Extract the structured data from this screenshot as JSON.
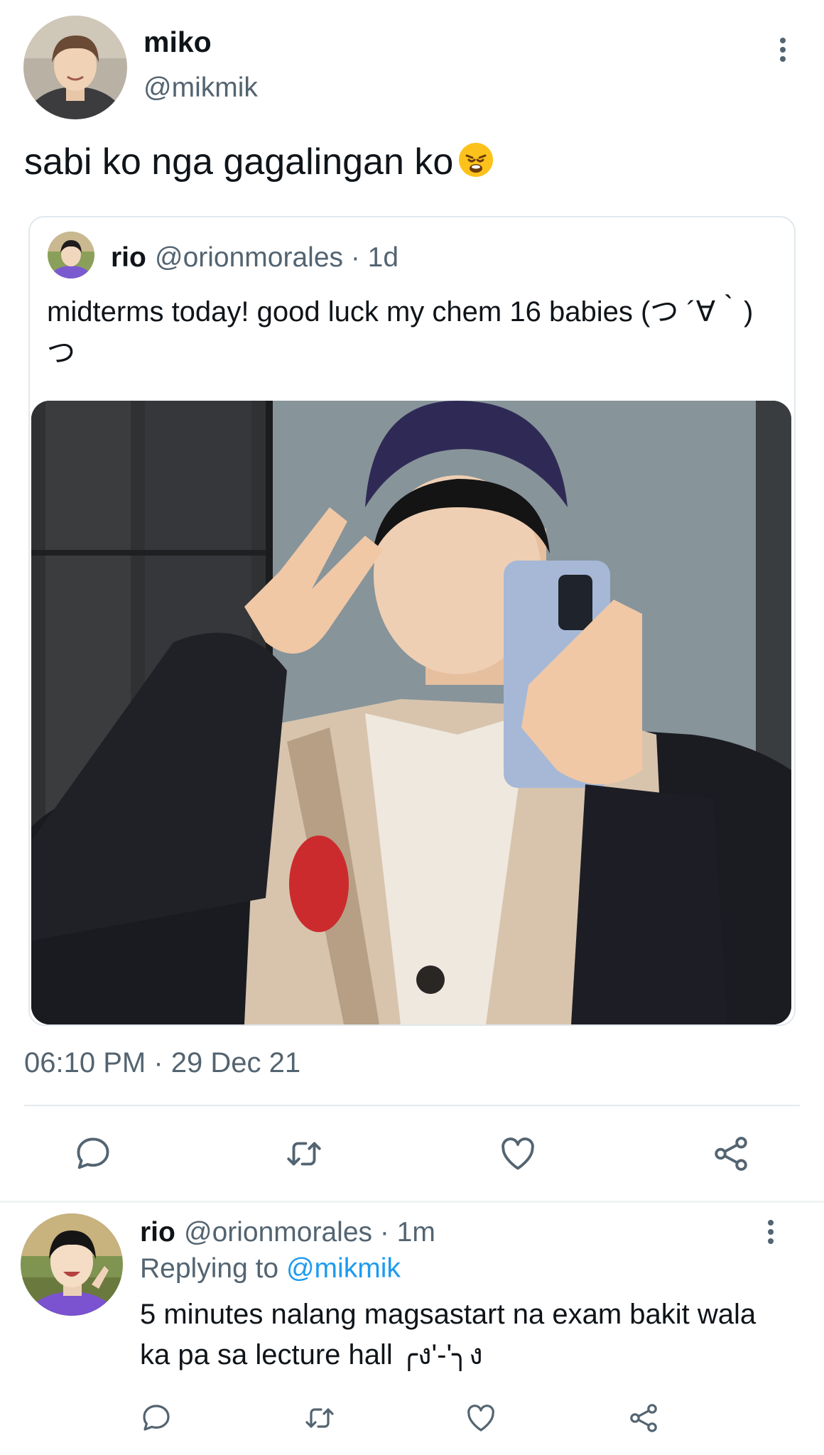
{
  "main_tweet": {
    "name": "miko",
    "handle": "@mikmik",
    "text": "sabi ko nga gagalingan ko",
    "emoji": "weary-face-emoji",
    "timestamp": "06:10 PM · 29 Dec 21"
  },
  "quoted_tweet": {
    "name": "rio",
    "handle_meta": "@orionmorales · 1d",
    "text": "midterms today! good luck my chem 16 babies (つ ´∀｀)つ",
    "photo": "mirror-selfie-photo"
  },
  "actions": {
    "icons": [
      "reply-icon",
      "retweet-icon",
      "like-icon",
      "share-icon"
    ]
  },
  "reply": {
    "name": "rio",
    "handle_meta": "@orionmorales · 1m",
    "replying_prefix": "Replying to",
    "replying_handle": "@mikmik",
    "text": "5 minutes nalang magsastart na exam bakit wala ka pa sa lecture hall ╭ง'-'╮ง"
  },
  "colors": {
    "text_primary": "#0f1419",
    "text_secondary": "#536471",
    "link": "#1d9bf0",
    "divider": "#e1e8ed"
  }
}
